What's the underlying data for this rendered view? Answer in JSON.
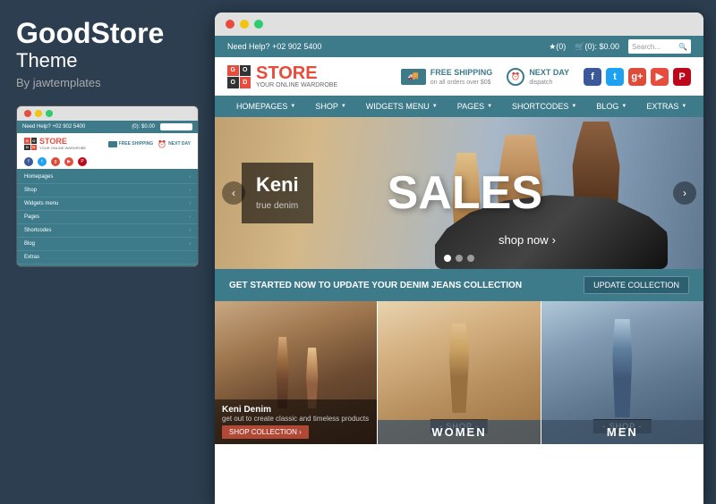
{
  "left": {
    "brand": "GoodStore",
    "theme": "Theme",
    "by": "By jawtemplates",
    "mini_topbar_help": "Need Help? +02 902 5400",
    "mini_cart": "(0): $0.00",
    "mini_nav_items": [
      {
        "label": "Homepages",
        "has_arrow": true
      },
      {
        "label": "Shop",
        "has_arrow": true
      },
      {
        "label": "Widgets menu",
        "has_arrow": true
      },
      {
        "label": "Pages",
        "has_arrow": true
      },
      {
        "label": "Shortcodes",
        "has_arrow": true
      },
      {
        "label": "Blog",
        "has_arrow": true
      },
      {
        "label": "Extras",
        "has_arrow": false
      }
    ],
    "logo_letters": [
      "G",
      "O",
      "O",
      "D"
    ],
    "store_text": "STORE",
    "wardrobe_text": "YOUR ONLINE WARDROBE"
  },
  "right": {
    "help_text": "Need Help? +02 902 5400",
    "wishlist": "★(0)",
    "cart": "🛒(0): $0.00",
    "search_placeholder": "Search...",
    "logo_letters": [
      "G",
      "O",
      "O",
      "D"
    ],
    "store_text": "STORE",
    "tagline": "YOUR ONLINE WARDROBE",
    "shipping_label": "FREE SHIPPING",
    "shipping_sub": "on all orders over $0$",
    "nextday_label": "NEXT DAY",
    "nextday_sub": "dispatch",
    "nav_items": [
      {
        "label": "HOMEPAGES",
        "has_arrow": true
      },
      {
        "label": "SHOP",
        "has_arrow": true
      },
      {
        "label": "WIDGETS MENU",
        "has_arrow": true
      },
      {
        "label": "PAGES",
        "has_arrow": true
      },
      {
        "label": "SHORTCODES",
        "has_arrow": true
      },
      {
        "label": "BLOG",
        "has_arrow": true
      },
      {
        "label": "EXTRAS",
        "has_arrow": true
      }
    ],
    "hero": {
      "name": "Keni",
      "sub": "true denim",
      "sales": "SALES",
      "shop_now": "shop now"
    },
    "banner": {
      "text": "GET STARTED NOW TO UPDATE YOUR DENIM JEANS COLLECTION",
      "button": "UPDATE COLLECTION"
    },
    "products": [
      {
        "title": "Keni Denim",
        "sub": "get out to create classic and timeless products",
        "btn": "SHOP COLLECTION ›",
        "gender": null
      },
      {
        "title": null,
        "sub": null,
        "btn": null,
        "shop_label": "- SHOP -",
        "gender": "WOMEN"
      },
      {
        "title": null,
        "sub": null,
        "btn": null,
        "shop_label": "- SHOP -",
        "gender": "MEN"
      }
    ]
  },
  "colors": {
    "teal": "#3d7a8a",
    "red": "#e74c3c",
    "dark": "#2c3e50"
  }
}
